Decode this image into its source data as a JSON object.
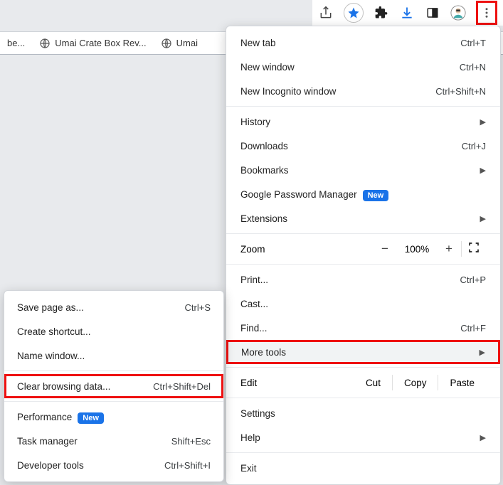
{
  "toolbar": {
    "share_icon": "share-icon",
    "star_icon": "star-icon",
    "puzzle_icon": "extensions-icon",
    "download_icon": "download-icon",
    "panel_icon": "panel-icon",
    "avatar_icon": "avatar-icon",
    "dots_icon": "more-icon"
  },
  "bookmarks_bar": {
    "item1_suffix": "be...",
    "item2": "Umai Crate Box Rev...",
    "item3": "Umai"
  },
  "main_menu": {
    "new_tab": "New tab",
    "new_tab_sc": "Ctrl+T",
    "new_window": "New window",
    "new_window_sc": "Ctrl+N",
    "new_incognito": "New Incognito window",
    "new_incognito_sc": "Ctrl+Shift+N",
    "history": "History",
    "downloads": "Downloads",
    "downloads_sc": "Ctrl+J",
    "bookmarks": "Bookmarks",
    "gpm": "Google Password Manager",
    "gpm_new": "New",
    "extensions": "Extensions",
    "zoom": "Zoom",
    "zoom_minus": "−",
    "zoom_val": "100%",
    "zoom_plus": "+",
    "print": "Print...",
    "print_sc": "Ctrl+P",
    "cast": "Cast...",
    "find": "Find...",
    "find_sc": "Ctrl+F",
    "more_tools": "More tools",
    "edit": "Edit",
    "cut": "Cut",
    "copy": "Copy",
    "paste": "Paste",
    "settings": "Settings",
    "help": "Help",
    "exit": "Exit"
  },
  "sub_menu": {
    "save_page": "Save page as...",
    "save_page_sc": "Ctrl+S",
    "create_shortcut": "Create shortcut...",
    "name_window": "Name window...",
    "clear_data": "Clear browsing data...",
    "clear_data_sc": "Ctrl+Shift+Del",
    "performance": "Performance",
    "perf_new": "New",
    "task_manager": "Task manager",
    "task_manager_sc": "Shift+Esc",
    "dev_tools": "Developer tools",
    "dev_tools_sc": "Ctrl+Shift+I"
  },
  "colors": {
    "highlight": "#e11",
    "badge": "#1a73e8"
  }
}
